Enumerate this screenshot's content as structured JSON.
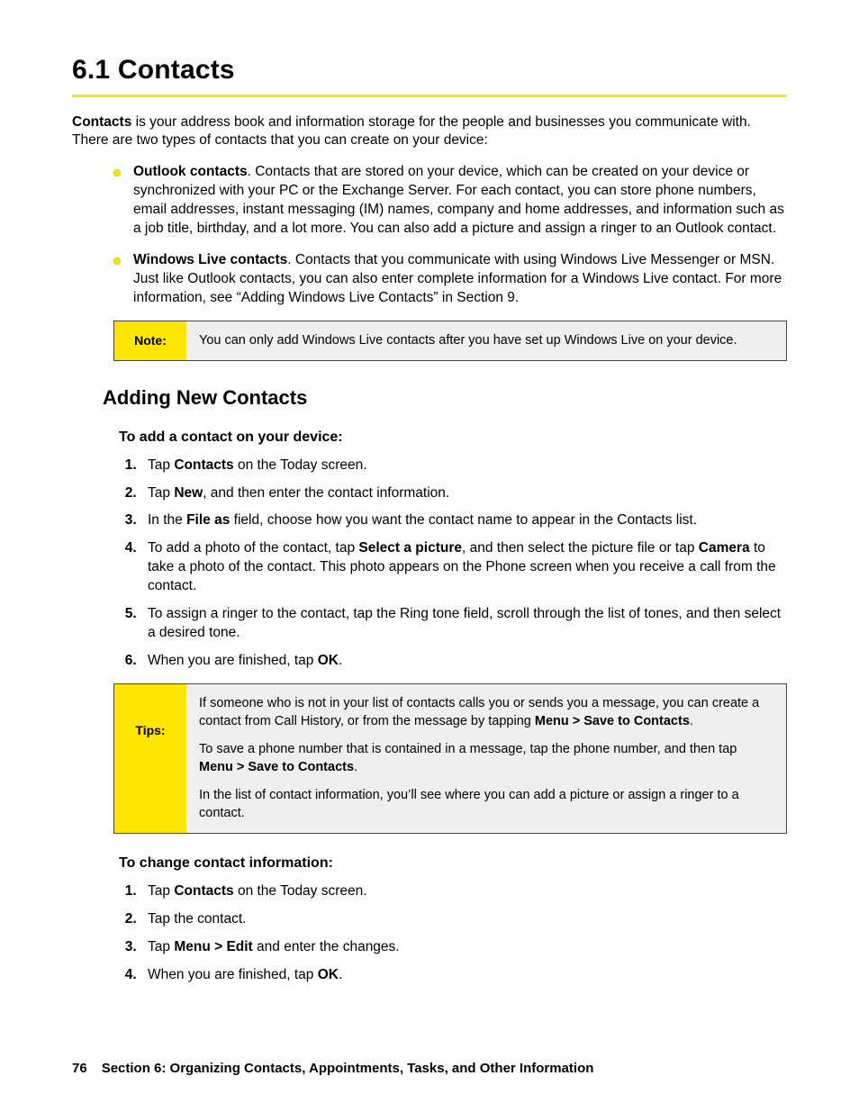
{
  "heading": "6.1  Contacts",
  "intro": {
    "lead_bold": "Contacts",
    "lead_rest": " is your address book and information storage for the people and businesses you communicate with. There are two types of contacts that you can create on your device:"
  },
  "bullets": [
    {
      "bold": "Outlook contacts",
      "rest": ". Contacts that are stored on your device, which can be created on your device or synchronized with your PC or the Exchange Server. For each contact, you can store phone numbers, email addresses, instant messaging (IM) names, company and home addresses, and information such as a job title, birthday, and a lot more. You can also add a picture and assign a ringer to an Outlook contact."
    },
    {
      "bold": "Windows Live contacts",
      "rest": ". Contacts that you communicate with using Windows Live Messenger or MSN. Just like Outlook contacts, you can also enter complete information for a Windows Live contact. For more information, see “Adding Windows Live Contacts” in Section 9."
    }
  ],
  "note": {
    "label": "Note:",
    "body": "You can only add Windows Live contacts after you have set up Windows Live on your device."
  },
  "sub": "Adding New Contacts",
  "task1": {
    "heading": "To add a contact on your device:",
    "steps": [
      {
        "pre": "Tap ",
        "b1": "Contacts",
        "post": " on the Today screen."
      },
      {
        "pre": "Tap ",
        "b1": "New",
        "post": ", and then enter the contact information."
      },
      {
        "pre": "In the ",
        "b1": "File as",
        "post": " field, choose how you want the contact name to appear in the Contacts list."
      },
      {
        "pre": "To add a photo of the contact, tap ",
        "b1": "Select a picture",
        "mid": ", and then select the picture file or tap ",
        "b2": "Camera",
        "post": " to take a photo of the contact. This photo appears on the Phone screen when you receive a call from the contact."
      },
      {
        "pre": "To assign a ringer to the contact, tap the Ring tone field, scroll through the list of tones, and then select a desired tone."
      },
      {
        "pre": "When you are finished, tap ",
        "b1": "OK",
        "post": "."
      }
    ]
  },
  "tips": {
    "label": "Tips:",
    "paras": [
      {
        "pre": "If someone who is not in your list of contacts calls you or sends you a message, you can create a contact from Call History, or from the message by tapping ",
        "b1": "Menu > Save to Contacts",
        "post": "."
      },
      {
        "pre": "To save a phone number that is contained in a message, tap the phone number, and then tap ",
        "b1": "Menu > Save to Contacts",
        "post": "."
      },
      {
        "pre": "In the list of contact information, you’ll see where you can add a picture or assign a ringer to a contact."
      }
    ]
  },
  "task2": {
    "heading": "To change contact information:",
    "steps": [
      {
        "pre": "Tap ",
        "b1": "Contacts",
        "post": " on the Today screen."
      },
      {
        "pre": "Tap the contact."
      },
      {
        "pre": "Tap ",
        "b1": "Menu > Edit",
        "post": " and enter the changes."
      },
      {
        "pre": "When you are finished, tap ",
        "b1": "OK",
        "post": "."
      }
    ]
  },
  "footer": {
    "page": "76",
    "section": "Section 6: Organizing Contacts, Appointments, Tasks, and Other Information"
  }
}
